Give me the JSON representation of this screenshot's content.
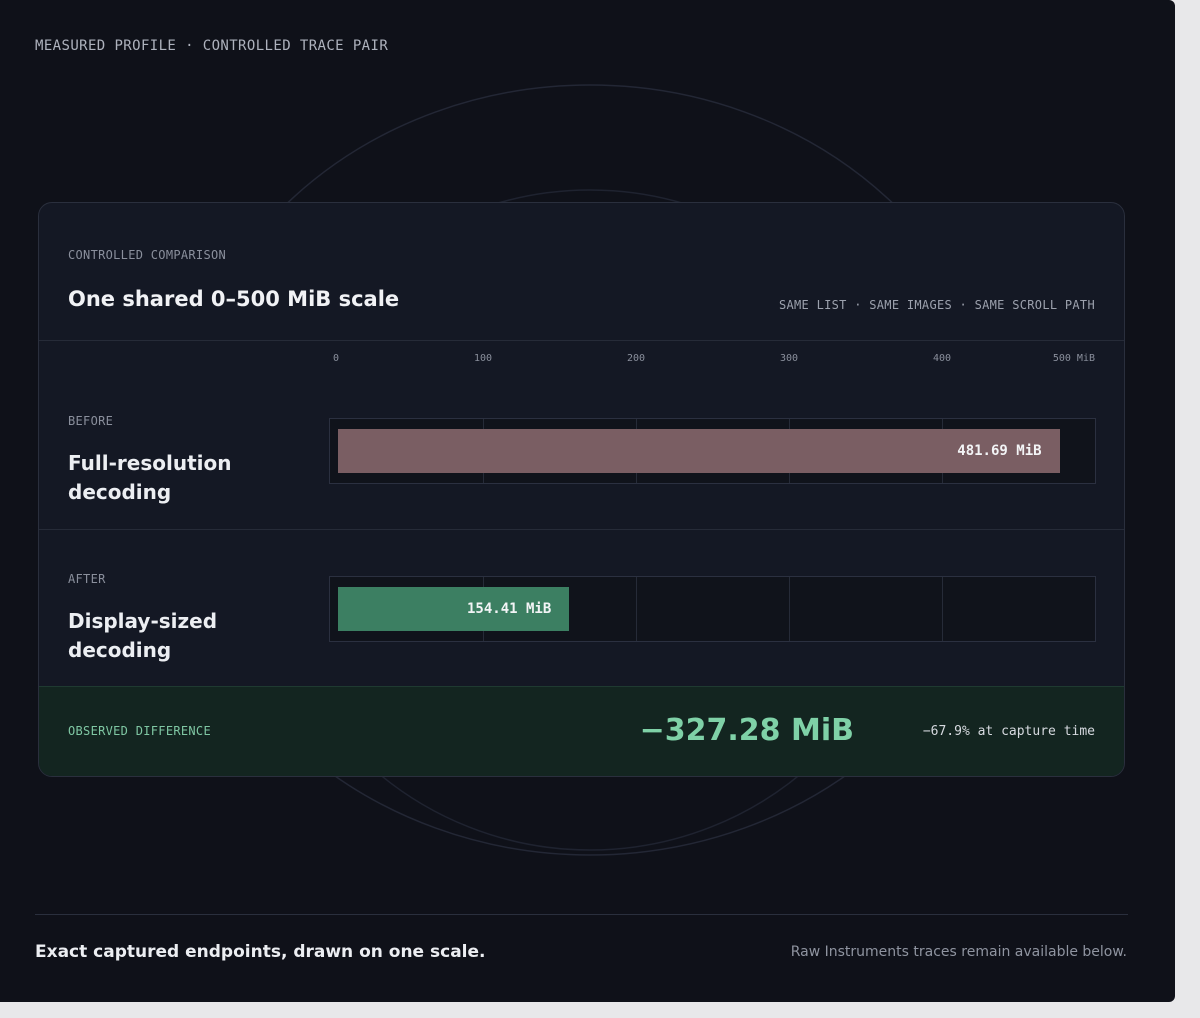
{
  "eyebrow": "MEASURED PROFILE · CONTROLLED TRACE PAIR",
  "card": {
    "kicker": "CONTROLLED COMPARISON",
    "title": "One shared 0–500 MiB scale",
    "tagline": "SAME LIST · SAME IMAGES · SAME SCROLL PATH"
  },
  "colors": {
    "before_bar": "#7a5e63",
    "after_bar": "#3c7f62",
    "difference": "#7fd1a7"
  },
  "chart_data": {
    "type": "bar",
    "orientation": "horizontal",
    "title": "One shared 0–500 MiB scale",
    "xlim": [
      0,
      500
    ],
    "x_ticks": [
      "0",
      "100",
      "200",
      "300",
      "400",
      "500 MiB"
    ],
    "categories": [
      "Full-resolution decoding",
      "Display-sized decoding"
    ],
    "series": [
      {
        "values": [
          481.69,
          154.41
        ],
        "value_labels": [
          "481.69 MiB",
          "154.41 MiB"
        ],
        "row_kickers": [
          "BEFORE",
          "AFTER"
        ]
      }
    ],
    "grid": true,
    "legend": "none"
  },
  "difference": {
    "kicker": "OBSERVED DIFFERENCE",
    "value": "−327.28 MiB",
    "percent": "−67.9% at capture time"
  },
  "footer": {
    "left": "Exact captured endpoints, drawn on one scale.",
    "right": "Raw Instruments traces remain available below."
  }
}
